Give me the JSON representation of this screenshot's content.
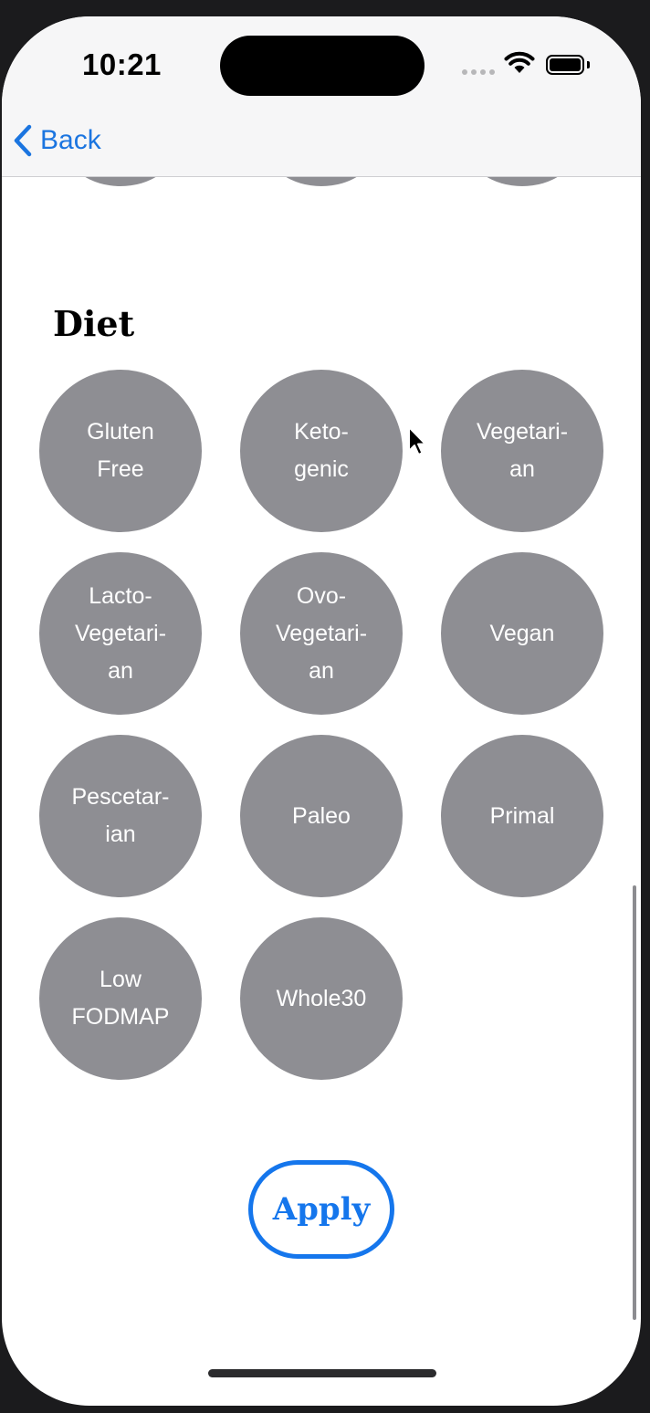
{
  "status_bar": {
    "time": "10:21"
  },
  "nav": {
    "back_label": "Back",
    "accent_color": "#1b75e0"
  },
  "section": {
    "title": "Diet"
  },
  "diets": [
    {
      "label": "Gluten\nFree"
    },
    {
      "label": "Keto-\ngenic"
    },
    {
      "label": "Vegetari-\nan"
    },
    {
      "label": "Lacto-\nVegetari-\nan"
    },
    {
      "label": "Ovo-\nVegetari-\nan"
    },
    {
      "label": "Vegan"
    },
    {
      "label": "Pescetar-\nian"
    },
    {
      "label": "Paleo"
    },
    {
      "label": "Primal"
    },
    {
      "label": "Low\nFODMAP"
    },
    {
      "label": "Whole30"
    }
  ],
  "apply_button": {
    "label": "Apply"
  },
  "colors": {
    "chip_background": "#8e8e93",
    "chip_text": "#ffffff",
    "apply_accent": "#1576ec"
  }
}
